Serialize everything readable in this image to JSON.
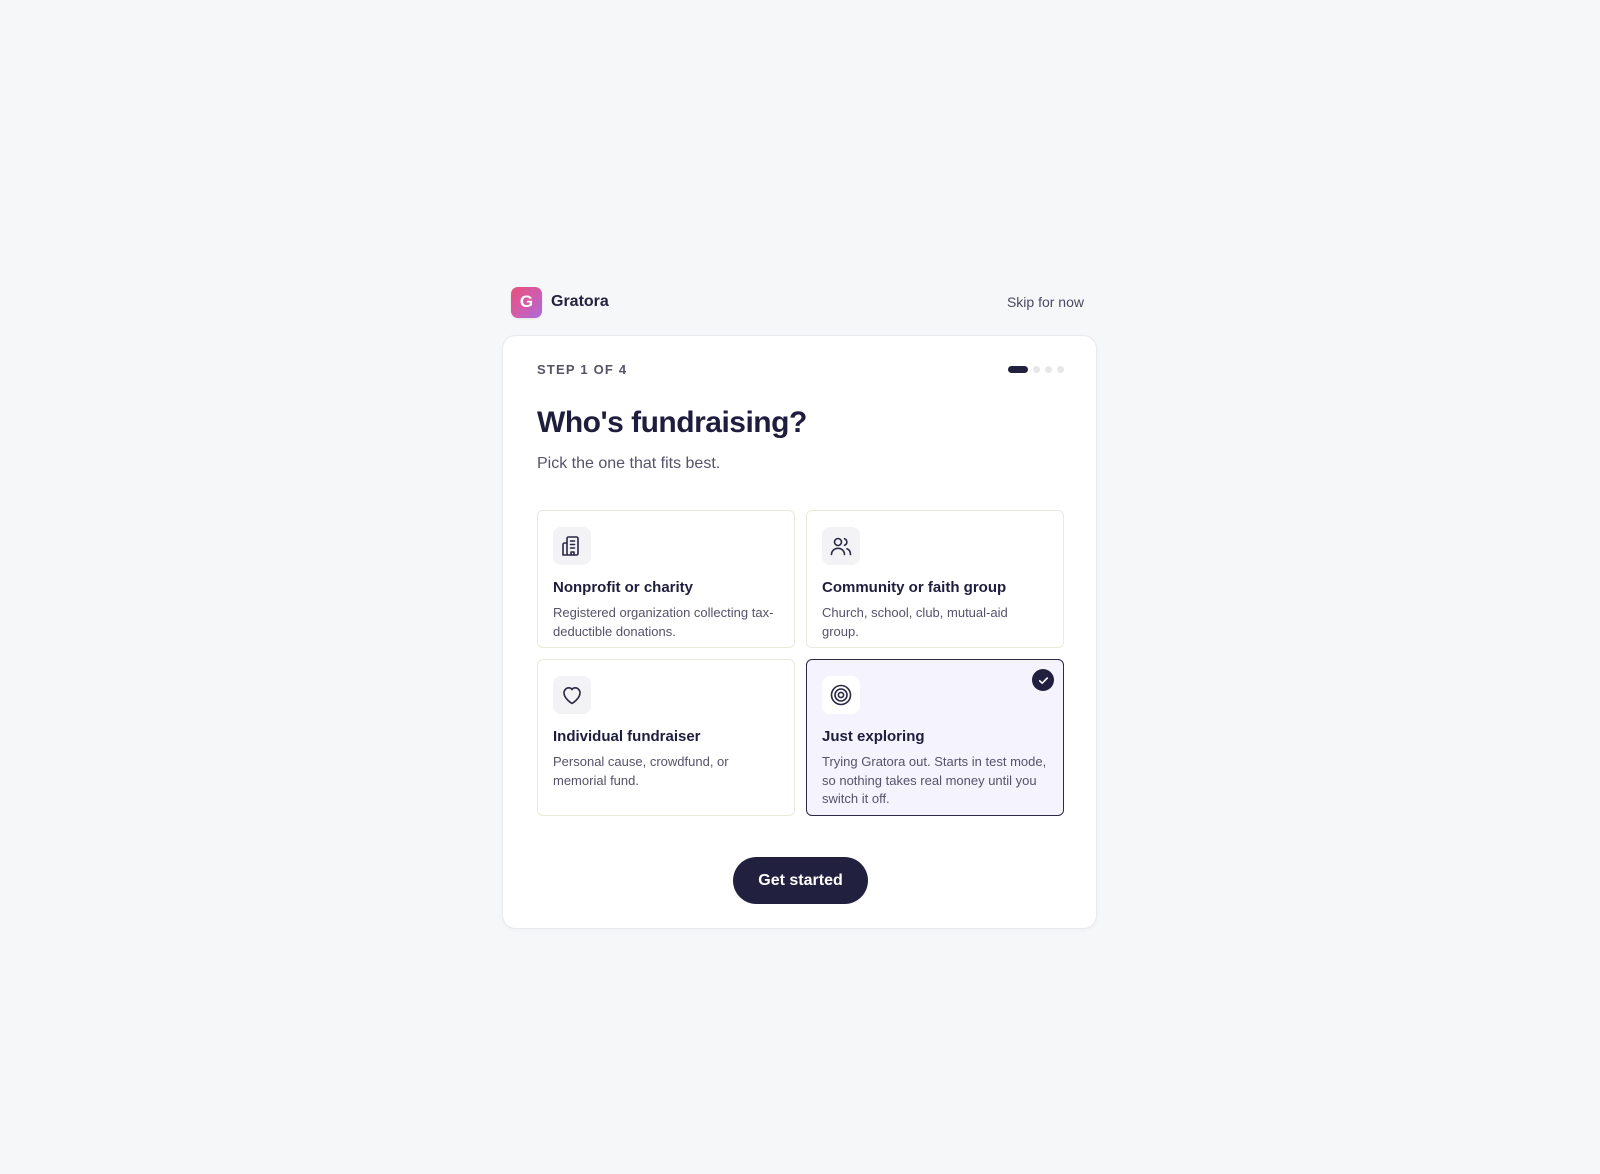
{
  "brand": {
    "logo_letter": "G",
    "name": "Gratora"
  },
  "header": {
    "skip_label": "Skip for now"
  },
  "progress": {
    "step_label": "STEP 1 OF 4",
    "current_step": 1,
    "total_steps": 4
  },
  "main": {
    "title": "Who's fundraising?",
    "subtitle": "Pick the one that fits best.",
    "options": [
      {
        "icon": "building-icon",
        "title": "Nonprofit or charity",
        "description": "Registered organization collecting tax-deductible donations.",
        "selected": false
      },
      {
        "icon": "users-icon",
        "title": "Community or faith group",
        "description": "Church, school, club, mutual-aid group.",
        "selected": false
      },
      {
        "icon": "heart-icon",
        "title": "Individual fundraiser",
        "description": "Personal cause, crowdfund, or memorial fund.",
        "selected": false
      },
      {
        "icon": "target-icon",
        "title": "Just exploring",
        "description": "Trying Gratora out. Starts in test mode, so nothing takes real money until you switch it off.",
        "selected": true
      }
    ],
    "cta_label": "Get started"
  },
  "colors": {
    "primary": "#22203f",
    "background": "#f6f7f9",
    "selected_bg": "#f5f3fd",
    "logo_gradient_start": "#e8507a",
    "logo_gradient_end": "#a86bd9"
  }
}
